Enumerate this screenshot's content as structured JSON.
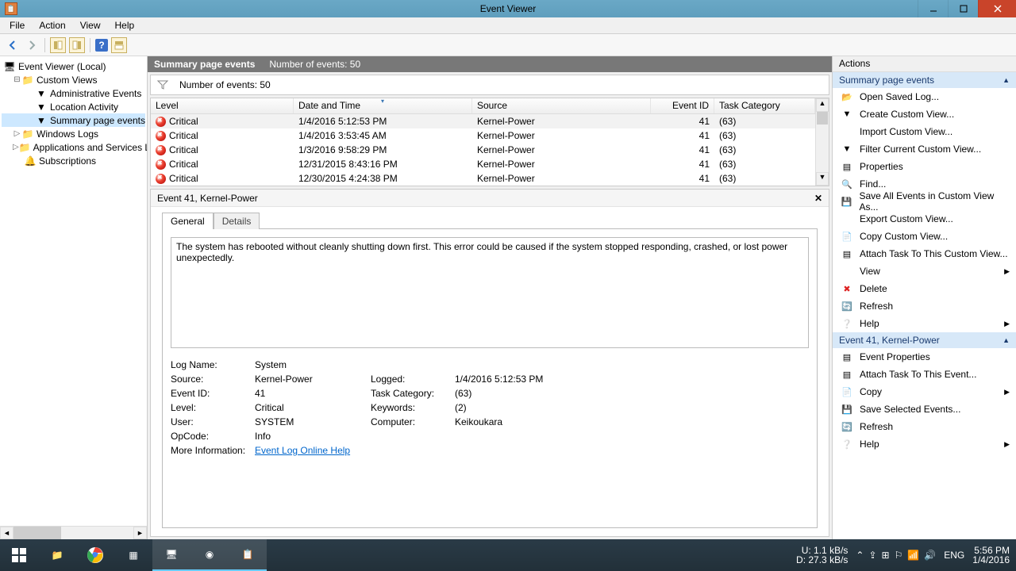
{
  "window": {
    "title": "Event Viewer"
  },
  "menu": {
    "file": "File",
    "action": "Action",
    "view": "View",
    "help": "Help"
  },
  "tree": {
    "root": "Event Viewer (Local)",
    "custom": "Custom Views",
    "admin": "Administrative Events",
    "location": "Location Activity",
    "summary": "Summary page events",
    "winlogs": "Windows Logs",
    "appsvc": "Applications and Services Lo",
    "subs": "Subscriptions"
  },
  "center": {
    "title": "Summary page events",
    "count_label": "Number of events: 50",
    "filter_count": "Number of events: 50",
    "columns": {
      "level": "Level",
      "date": "Date and Time",
      "source": "Source",
      "eid": "Event ID",
      "task": "Task Category"
    },
    "rows": [
      {
        "level": "Critical",
        "date": "1/4/2016 5:12:53 PM",
        "source": "Kernel-Power",
        "eid": "41",
        "task": "(63)"
      },
      {
        "level": "Critical",
        "date": "1/4/2016 3:53:45 AM",
        "source": "Kernel-Power",
        "eid": "41",
        "task": "(63)"
      },
      {
        "level": "Critical",
        "date": "1/3/2016 9:58:29 PM",
        "source": "Kernel-Power",
        "eid": "41",
        "task": "(63)"
      },
      {
        "level": "Critical",
        "date": "12/31/2015 8:43:16 PM",
        "source": "Kernel-Power",
        "eid": "41",
        "task": "(63)"
      },
      {
        "level": "Critical",
        "date": "12/30/2015 4:24:38 PM",
        "source": "Kernel-Power",
        "eid": "41",
        "task": "(63)"
      }
    ]
  },
  "detail": {
    "header": "Event 41, Kernel-Power",
    "tabs": {
      "general": "General",
      "details": "Details"
    },
    "message": "The system has rebooted without cleanly shutting down first. This error could be caused if the system stopped responding, crashed, or lost power unexpectedly.",
    "labels": {
      "logname": "Log Name:",
      "source": "Source:",
      "eventid": "Event ID:",
      "level": "Level:",
      "user": "User:",
      "opcode": "OpCode:",
      "moreinfo": "More Information:",
      "logged": "Logged:",
      "taskcat": "Task Category:",
      "keywords": "Keywords:",
      "computer": "Computer:"
    },
    "values": {
      "logname": "System",
      "source": "Kernel-Power",
      "eventid": "41",
      "level": "Critical",
      "user": "SYSTEM",
      "opcode": "Info",
      "logged": "1/4/2016 5:12:53 PM",
      "taskcat": "(63)",
      "keywords": "(2)",
      "computer": "Keikoukara",
      "link": "Event Log Online Help"
    }
  },
  "actions": {
    "title": "Actions",
    "group1": "Summary page events",
    "items1": [
      "Open Saved Log...",
      "Create Custom View...",
      "Import Custom View...",
      "Filter Current Custom View...",
      "Properties",
      "Find...",
      "Save All Events in Custom View As...",
      "Export Custom View...",
      "Copy Custom View...",
      "Attach Task To This Custom View...",
      "View",
      "Delete",
      "Refresh",
      "Help"
    ],
    "group2": "Event 41, Kernel-Power",
    "items2": [
      "Event Properties",
      "Attach Task To This Event...",
      "Copy",
      "Save Selected Events...",
      "Refresh",
      "Help"
    ]
  },
  "taskbar": {
    "net_up_label": "U:",
    "net_dn_label": "D:",
    "net_up": "1.1 kB/s",
    "net_dn": "27.3 kB/s",
    "lang": "ENG",
    "time": "5:56 PM",
    "date": "1/4/2016"
  }
}
